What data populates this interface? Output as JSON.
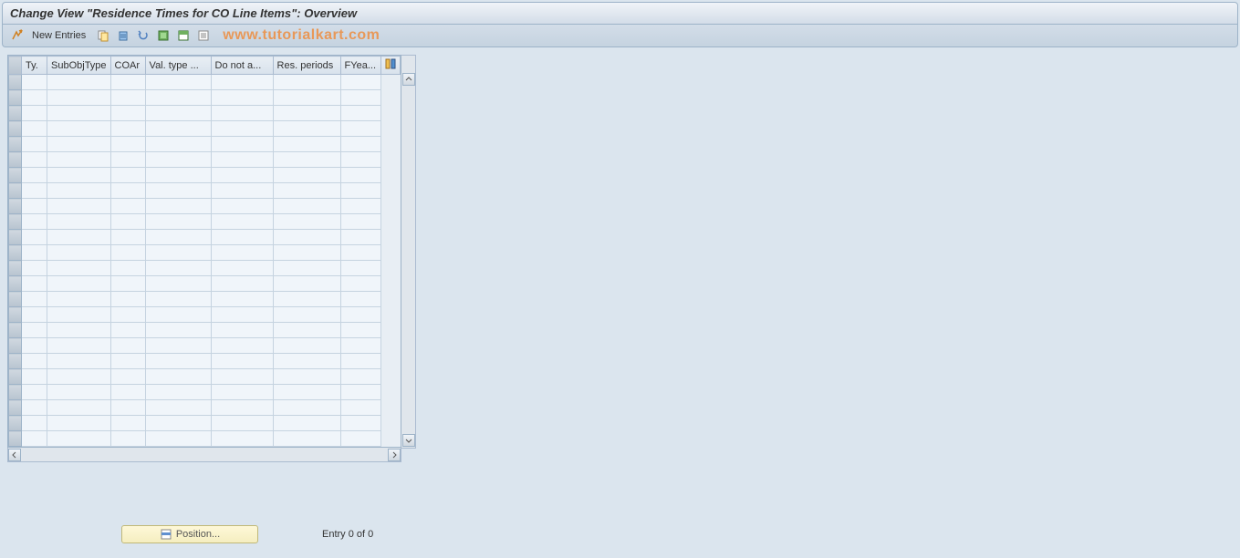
{
  "header": {
    "title": "Change View \"Residence Times for CO Line Items\": Overview"
  },
  "toolbar": {
    "new_entries_label": "New Entries"
  },
  "watermark": "www.tutorialkart.com",
  "table": {
    "columns": [
      "Ty.",
      "SubObjType",
      "COAr",
      "Val. type ...",
      "Do not a...",
      "Res. periods",
      "FYea..."
    ],
    "rows": 24
  },
  "footer": {
    "position_label": "Position...",
    "entry_text": "Entry 0 of 0"
  }
}
